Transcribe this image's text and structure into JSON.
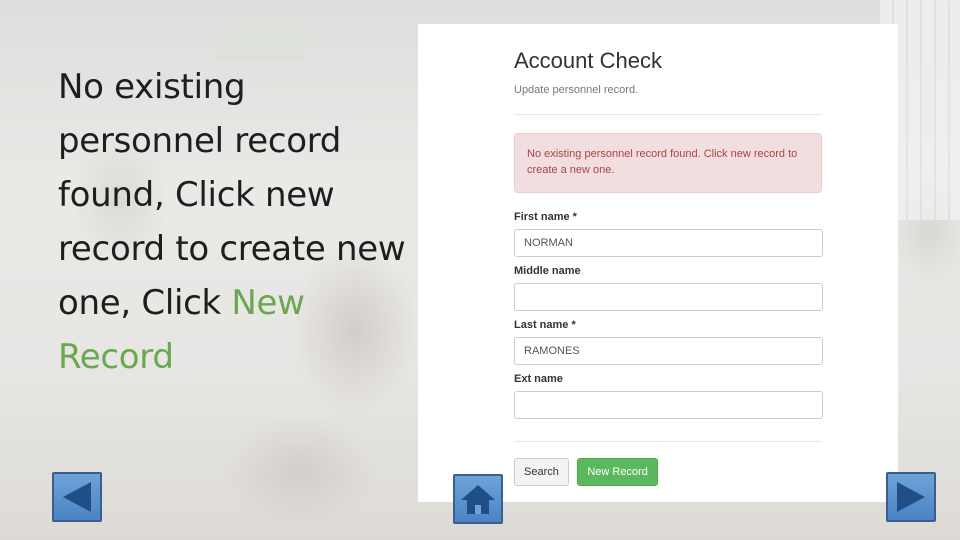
{
  "slide": {
    "text_before": "No existing personnel record found, Click new record to create new one, Click ",
    "text_accent": "New Record"
  },
  "form": {
    "title": "Account Check",
    "subtitle": "Update personnel record.",
    "alert": "No existing personnel record found. Click new record to create a new one.",
    "fields": [
      {
        "label": "First name *",
        "value": "NORMAN"
      },
      {
        "label": "Middle name",
        "value": ""
      },
      {
        "label": "Last name *",
        "value": "RAMONES"
      },
      {
        "label": "Ext name",
        "value": ""
      }
    ],
    "buttons": {
      "search": "Search",
      "new_record": "New Record"
    }
  },
  "nav": {
    "prev_icon": "previous-arrow-icon",
    "home_icon": "home-icon",
    "next_icon": "next-arrow-icon"
  },
  "colors": {
    "accent_text": "#6aa84f",
    "alert_bg": "#f2dede",
    "alert_text": "#a94442",
    "success_button": "#5cb85c",
    "nav_button": "#4a84c4"
  }
}
